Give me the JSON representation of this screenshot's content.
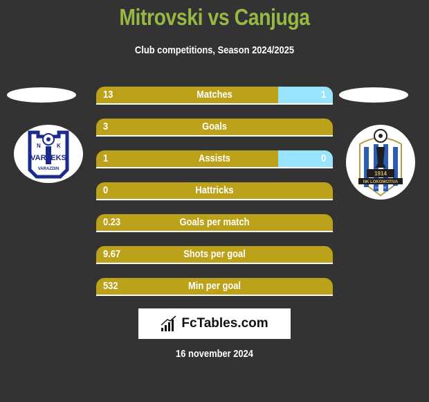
{
  "header": {
    "title": "Mitrovski vs Canjuga",
    "subtitle": "Club competitions, Season 2024/2025"
  },
  "players": {
    "left": {
      "team_logo": "nk-varteks-varazdin-logo",
      "logo_text": [
        "N",
        "K",
        "VARTEKS",
        "VARAZDIN"
      ]
    },
    "right": {
      "team_logo": "nk-lokomotiva-zagreb-logo",
      "logo_text": [
        "1914",
        "NK LOKOMOTIVA",
        "ZAGREB"
      ]
    }
  },
  "colors": {
    "title": "#97b944",
    "bar_left": "#bba21a",
    "bar_right": "#99e3fc",
    "background": "#333333"
  },
  "stats": [
    {
      "label": "Matches",
      "left": "13",
      "right": "1"
    },
    {
      "label": "Goals",
      "left": "3",
      "right": null
    },
    {
      "label": "Assists",
      "left": "1",
      "right": "0"
    },
    {
      "label": "Hattricks",
      "left": "0",
      "right": null
    },
    {
      "label": "Goals per match",
      "left": "0.23",
      "right": null
    },
    {
      "label": "Shots per goal",
      "left": "9.67",
      "right": null
    },
    {
      "label": "Min per goal",
      "left": "532",
      "right": null
    }
  ],
  "brand": {
    "icon": "bar-chart-icon",
    "text": "FcTables.com"
  },
  "footer": {
    "date": "16 november 2024"
  }
}
